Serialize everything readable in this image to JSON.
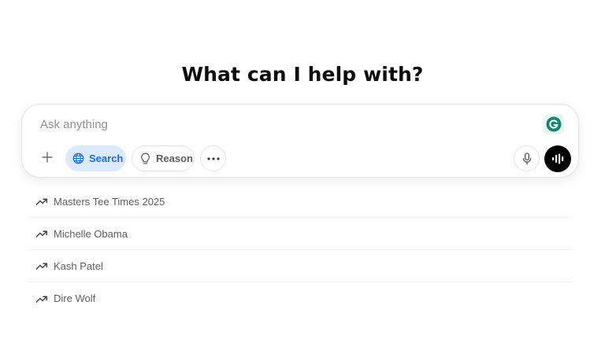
{
  "headline": "What can I help with?",
  "composer": {
    "placeholder": "Ask anything",
    "value": ""
  },
  "toolbar": {
    "plus_glyph": "+",
    "search_label": "Search",
    "reason_label": "Reason",
    "more_glyph": "•••",
    "icons": {
      "plus": "plus-icon",
      "search": "globe-icon",
      "reason": "lightbulb-icon",
      "more": "ellipsis-icon",
      "mic": "microphone-icon",
      "voice": "voice-mode-icon",
      "extension": "grammarly-icon"
    }
  },
  "suggestions": [
    {
      "label": "Masters Tee Times 2025",
      "icon": "trending-icon"
    },
    {
      "label": "Michelle Obama",
      "icon": "trending-icon"
    },
    {
      "label": "Kash Patel",
      "icon": "trending-icon"
    },
    {
      "label": "Dire Wolf",
      "icon": "trending-icon"
    }
  ],
  "colors": {
    "accent_blue": "#1a6fd1",
    "accent_blue_bg": "#dbeafe",
    "voice_button": "#000000",
    "grammarly": "#14866d"
  }
}
